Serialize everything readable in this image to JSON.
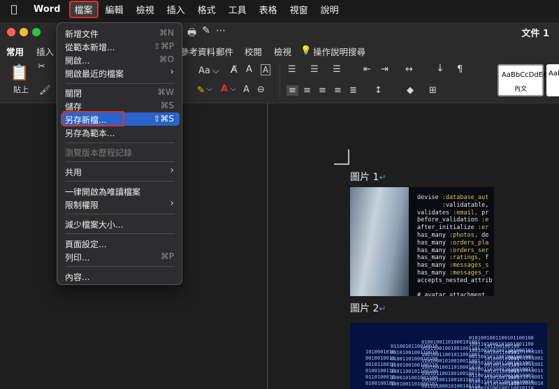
{
  "menubar": {
    "app": "Word",
    "items": [
      "檔案",
      "編輯",
      "檢視",
      "插入",
      "格式",
      "工具",
      "表格",
      "視窗",
      "說明"
    ]
  },
  "window": {
    "doc_title": "文件 1"
  },
  "ribbon": {
    "tabs": [
      "常用",
      "插入",
      "參考資料",
      "郵件",
      "校閱",
      "檢視"
    ],
    "tell_me": "操作說明搜尋",
    "paste_label": "貼上",
    "font_size_label": "Aa",
    "style_sample": "AaBbCcDdEe",
    "style_name": "內文",
    "style_sample2": "AaBbC"
  },
  "file_menu": {
    "items": [
      {
        "label": "新增文件",
        "shortcut": "⌘N"
      },
      {
        "label": "從範本新增...",
        "shortcut": "⇧⌘P"
      },
      {
        "label": "開啟...",
        "shortcut": "⌘O"
      },
      {
        "label": "開啟最近的檔案",
        "shortcut": "›"
      },
      {
        "label": "關閉",
        "shortcut": "⌘W"
      },
      {
        "label": "儲存",
        "shortcut": "⌘S"
      },
      {
        "label": "另存新檔...",
        "shortcut": "⇧⌘S"
      },
      {
        "label": "另存為範本...",
        "shortcut": ""
      },
      {
        "label": "瀏覽版本歷程記錄",
        "shortcut": ""
      },
      {
        "label": "共用",
        "shortcut": "›"
      },
      {
        "label": "一律開啟為唯讀檔案",
        "shortcut": ""
      },
      {
        "label": "限制權限",
        "shortcut": "›"
      },
      {
        "label": "減少檔案大小...",
        "shortcut": ""
      },
      {
        "label": "頁面設定...",
        "shortcut": ""
      },
      {
        "label": "列印...",
        "shortcut": "⌘P"
      },
      {
        "label": "內容...",
        "shortcut": ""
      }
    ]
  },
  "document": {
    "caption1": "圖片 1",
    "caption2": "圖片 2",
    "paragraph_mark": "↵",
    "code_lines": [
      "devise :database_aut",
      "       :validatable,",
      "validates :email, pr",
      "before_validation :e",
      "after_initialize :er",
      "has_many :photos, de",
      "has_many :orders_pla",
      "has_many :orders_ser",
      "has_many :ratings, f",
      "has_many :messages_s",
      "has_many :messages_r",
      "accepts_nested_attrib",
      "",
      "# avatar attachment"
    ],
    "binary_text": "1000101010010100001010101010010101"
  },
  "colors": {
    "highlight": "#2a63c9",
    "annotation_box": "#e0302a",
    "paragraph_mark": "#4d8ee8"
  }
}
